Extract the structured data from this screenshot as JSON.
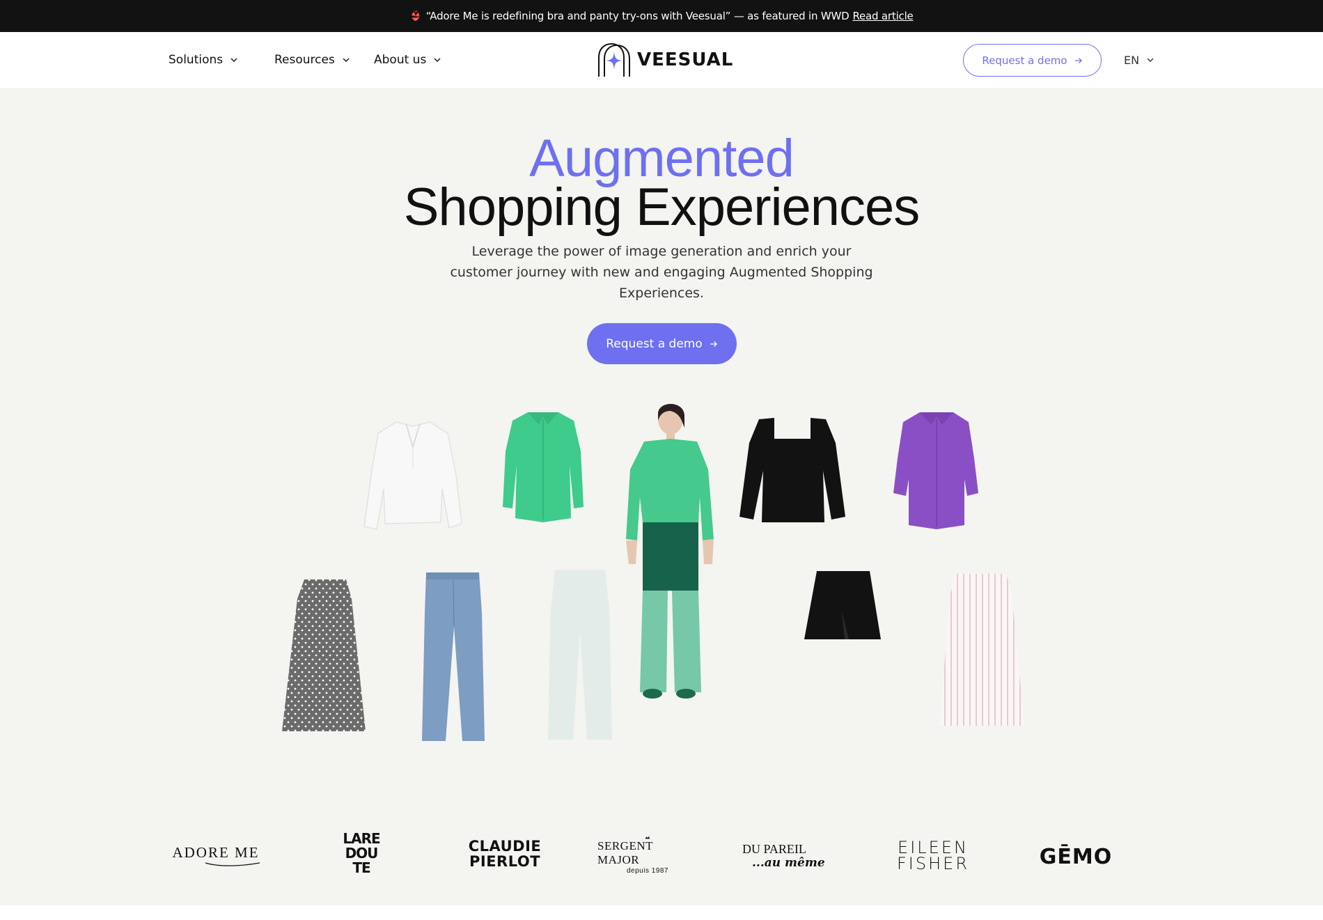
{
  "banner": {
    "icon": "bikini-icon",
    "icon_glyph": "👙",
    "text": "“Adore Me is redefining bra and panty try-ons with Veesual” — as featured in WWD",
    "link_label": "Read article"
  },
  "nav": {
    "items": [
      {
        "label": "Solutions",
        "icon": "chevron-down-icon"
      },
      {
        "label": "Resources",
        "icon": "chevron-down-icon"
      },
      {
        "label": "About us",
        "icon": "chevron-down-icon"
      }
    ],
    "logo_text": "VEESUAL",
    "cta_label": "Request a demo",
    "cta_icon": "arrow-right-icon",
    "language": "EN"
  },
  "hero": {
    "title_accent": "Augmented",
    "title_main": "Shopping Experiences",
    "subtitle": "Leverage the power of image generation and enrich your customer journey with new and engaging Augmented Shopping Experiences.",
    "cta_label": "Request a demo",
    "cta_icon": "arrow-right-icon"
  },
  "garments": [
    {
      "name": "white-ruffle-blouse",
      "color": "#f7f7f7"
    },
    {
      "name": "green-shirt",
      "color": "#3dcb8a"
    },
    {
      "name": "black-square-neck-top",
      "color": "#111111"
    },
    {
      "name": "purple-shirt",
      "color": "#8a4fc4"
    },
    {
      "name": "polka-dot-pleated-skirt",
      "color": "#6e6e6e"
    },
    {
      "name": "blue-jeans",
      "color": "#7c9cc0"
    },
    {
      "name": "faded-wide-pants",
      "color": "#e3ece8"
    },
    {
      "name": "black-mini-skirt",
      "color": "#111111"
    },
    {
      "name": "striped-pleated-skirt",
      "color": "#f3e7ea"
    }
  ],
  "model": {
    "name": "model-wearing-outfit",
    "shirt_color": "#45c98c",
    "shorts_color": "#17624a",
    "pants_color": "#5fbf9a"
  },
  "brands": [
    {
      "name": "Adore Me",
      "line1": "ADORE ME"
    },
    {
      "name": "La Redoute",
      "line1": "LARE",
      "line2": "DOU",
      "line3": "TE"
    },
    {
      "name": "Claudie Pierlot",
      "line1": "CLAUDIE",
      "line2": "PIERLOT"
    },
    {
      "name": "Sergent Major",
      "line1": "SERGENT MAJOR",
      "line2": "depuis 1987"
    },
    {
      "name": "Du Pareil au Même",
      "line1": "DU PAREIL",
      "line2": "...au même"
    },
    {
      "name": "Eileen Fisher",
      "line1": "EILEEN",
      "line2": "FISHER"
    },
    {
      "name": "Gémo",
      "line1": "GĒMO"
    }
  ],
  "colors": {
    "accent": "#6e70f0",
    "banner_bg": "#121212",
    "hero_bg": "#f4f4f1"
  }
}
